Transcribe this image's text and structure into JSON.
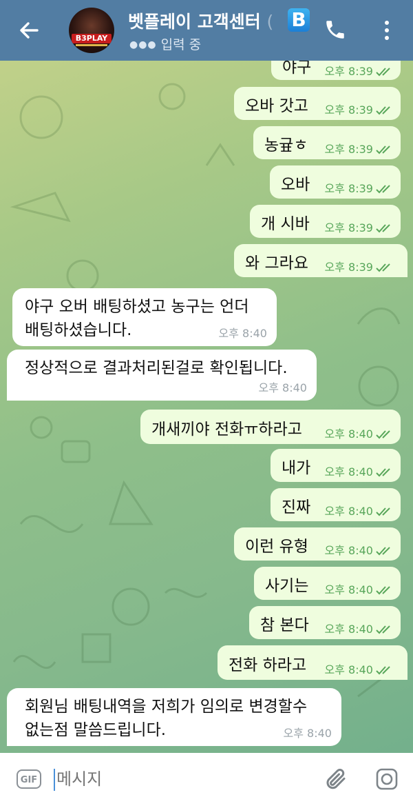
{
  "header": {
    "title": "벳플레이 고객센터",
    "title_ghost": "(",
    "badge": "B",
    "status": "입력 중",
    "avatar_logo": "B3PLAY"
  },
  "messages": {
    "m1": {
      "text": "야구",
      "time": "오후 8:39"
    },
    "m2": {
      "text": "오바 갓고",
      "time": "오후 8:39"
    },
    "m3": {
      "text": "농귶ㅎ",
      "time": "오후 8:39"
    },
    "m4": {
      "text": "오바",
      "time": "오후 8:39"
    },
    "m5": {
      "text": "개 시바",
      "time": "오후 8:39"
    },
    "m6": {
      "text": "와 그라요",
      "time": "오후 8:39"
    },
    "m7": {
      "line1": "야구 오버 배팅하셨고 농구는 언더",
      "line2": "배팅하셨습니다.",
      "time": "오후 8:40"
    },
    "m8": {
      "text": "정상적으로 결과처리된걸로 확인됩니다.",
      "time": "오후 8:40"
    },
    "m9": {
      "text": "개새끼야 전화ㅠ하라고",
      "time": "오후 8:40"
    },
    "m10": {
      "text": "내가",
      "time": "오후 8:40"
    },
    "m11": {
      "text": "진짜",
      "time": "오후 8:40"
    },
    "m12": {
      "text": "이런 유형",
      "time": "오후 8:40"
    },
    "m13": {
      "text": "사기는",
      "time": "오후 8:40"
    },
    "m14": {
      "text": "참 본다",
      "time": "오후 8:40"
    },
    "m15": {
      "text": "전화 하라고",
      "time": "오후 8:40"
    },
    "m16": {
      "line1": "회원님 배팅내역을 저희가 임의로 변경할수",
      "line2": "없는점 말씀드립니다.",
      "time": "오후 8:40"
    }
  },
  "input": {
    "gif_label": "GIF",
    "placeholder": "메시지"
  },
  "colors": {
    "header": "#527da3",
    "outgoing_bubble": "#effdde",
    "incoming_bubble": "#ffffff",
    "check": "#58a65a"
  }
}
